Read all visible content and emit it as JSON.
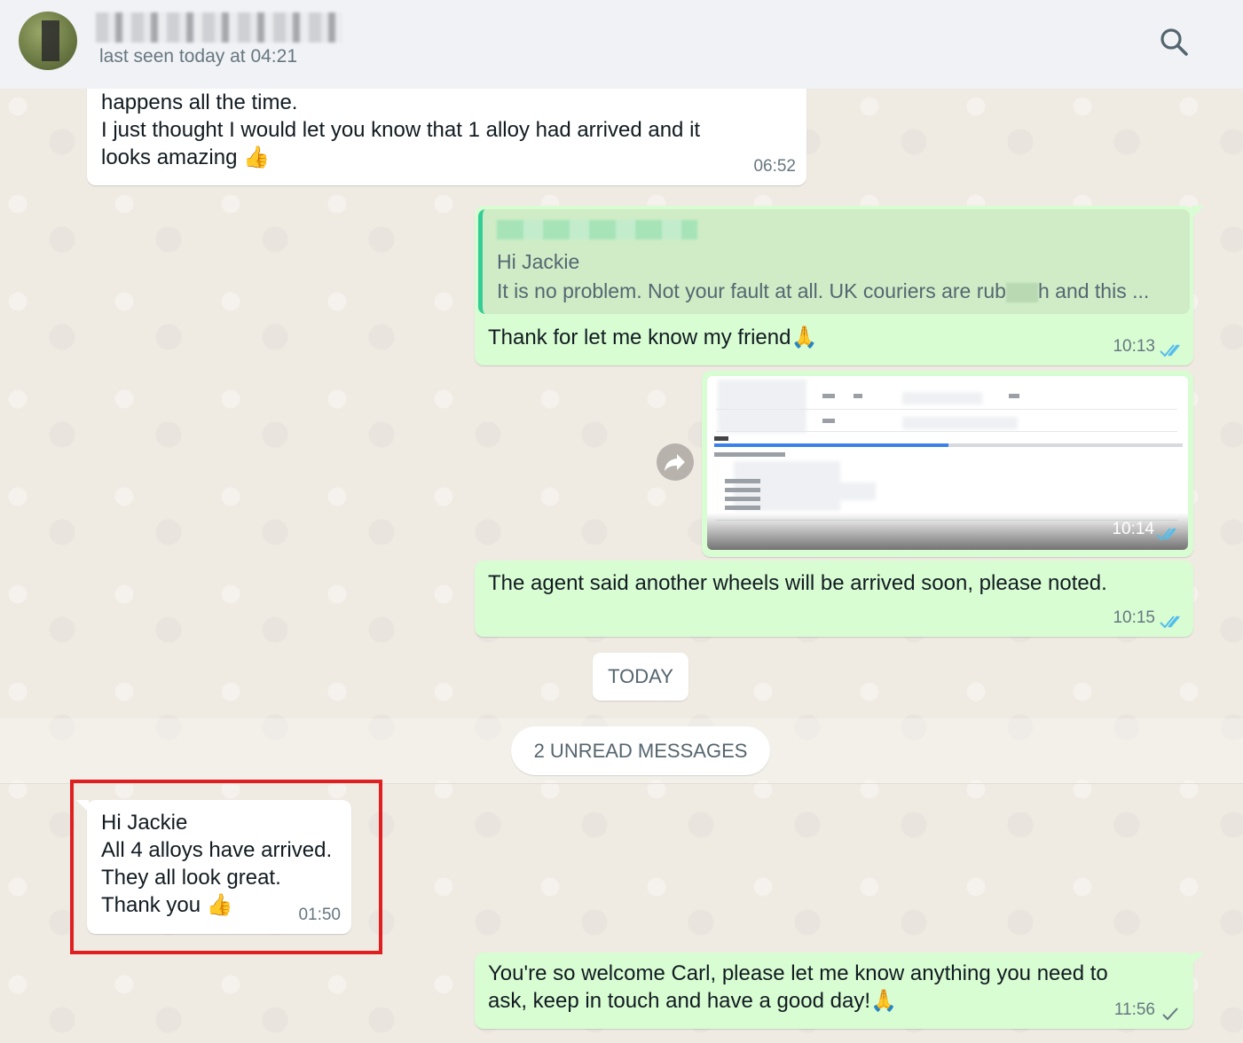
{
  "header": {
    "last_seen": "last seen today at 04:21"
  },
  "messages": {
    "m1": {
      "line1": "happens all the time.",
      "line2": "I just thought I would let you know that 1 alloy had arrived and it",
      "line3": "looks amazing",
      "emoji": "👍",
      "time": "06:52"
    },
    "m2": {
      "quote_line1": "Hi Jackie",
      "quote_line2a": "It is no problem. Not your fault at all. UK couriers are rub",
      "quote_line2b": "h and this ...",
      "text": "Thank for let me know my friend",
      "emoji": "🙏",
      "time": "10:13"
    },
    "m3": {
      "time": "10:14"
    },
    "m4": {
      "text": "The agent said another wheels will be arrived soon, please noted.",
      "time": "10:15"
    },
    "m5": {
      "line1": "Hi Jackie",
      "line2": "All 4 alloys have arrived.",
      "line3": "They all look great.",
      "line4": "Thank you",
      "emoji": "👍",
      "time": "01:50"
    },
    "m6": {
      "line1": "You're so welcome Carl, please let me know anything you need to",
      "line2": "ask, keep in touch and have a good day!",
      "emoji": "🙏",
      "time": "11:56"
    }
  },
  "separators": {
    "today": "TODAY",
    "unread": "2 UNREAD MESSAGES"
  },
  "colors": {
    "chat_bg": "#efeae2",
    "incoming": "#ffffff",
    "outgoing": "#d9fdd3",
    "read_ticks": "#53bdeb",
    "highlight": "#e02020"
  }
}
